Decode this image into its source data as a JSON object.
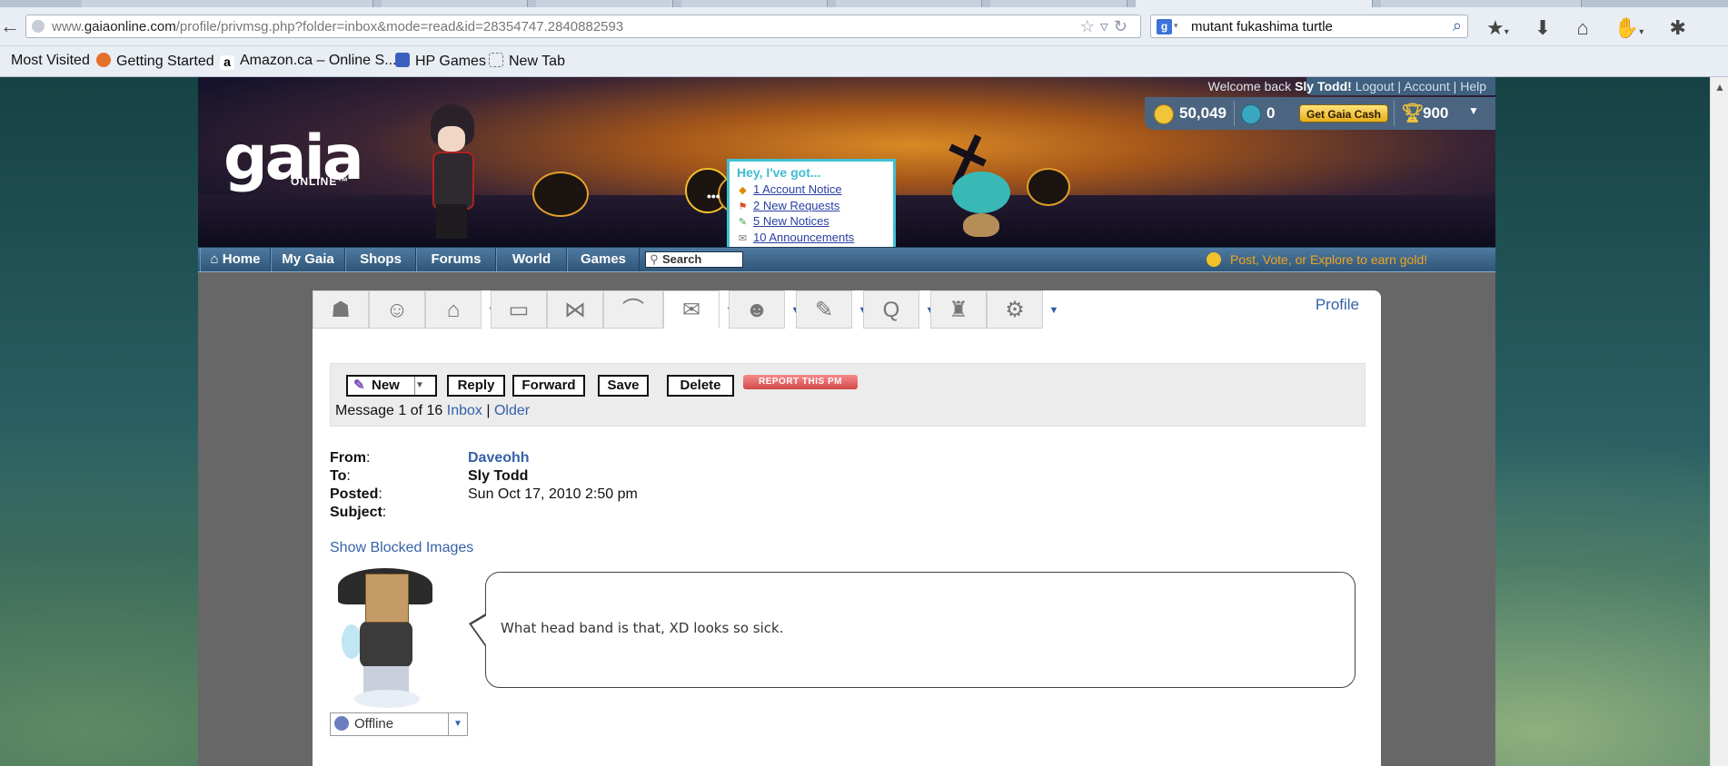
{
  "browser": {
    "url_prefix": "www.",
    "url_domain": "gaiaonline.com",
    "url_path": "/profile/privmsg.php?folder=inbox&mode=read&id=28354747.2840882593",
    "search_query": "mutant fukashima turtle",
    "bookmarks": [
      "Most Visited",
      "Getting Started",
      "Amazon.ca – Online S...",
      "HP Games",
      "New Tab"
    ]
  },
  "header": {
    "logo": "gaia",
    "logo_sub": "ONLINE™",
    "notice_title": "Hey, I've got...",
    "notices": [
      {
        "label": "1 Account Notice",
        "icon": "warning-icon"
      },
      {
        "label": "2 New Requests",
        "icon": "flag-icon"
      },
      {
        "label": "5 New Notices",
        "icon": "pin-icon"
      },
      {
        "label": "10 Announcements",
        "icon": "megaphone-icon"
      }
    ],
    "welcome_prefix": "Welcome back",
    "username": "Sly Todd!",
    "logout": "Logout",
    "account": "Account",
    "help": "Help",
    "gold": "50,049",
    "gaia_cash": "0",
    "get_cash": "Get Gaia Cash",
    "trophies": "900"
  },
  "nav": {
    "items": [
      "Home",
      "My Gaia",
      "Shops",
      "Forums",
      "World",
      "Games"
    ],
    "search_placeholder": "Search",
    "earn": "Post, Vote, or Explore to earn gold!"
  },
  "profile_link": "Profile",
  "toolbar": {
    "new": "New",
    "reply": "Reply",
    "forward": "Forward",
    "save": "Save",
    "delete": "Delete",
    "report": "REPORT THIS PM",
    "msg_count": "Message 1 of 16",
    "inbox": "Inbox",
    "sep": "|",
    "older": "Older"
  },
  "message": {
    "from_label": "From",
    "to_label": "To",
    "posted_label": "Posted",
    "subject_label": "Subject",
    "colon": ":",
    "from": "Daveohh",
    "to": "Sly Todd",
    "posted": "Sun Oct 17, 2010 2:50 pm",
    "subject": "",
    "show_blocked": "Show Blocked Images",
    "body": "What head band is that, XD looks so sick.",
    "status": "Offline"
  }
}
